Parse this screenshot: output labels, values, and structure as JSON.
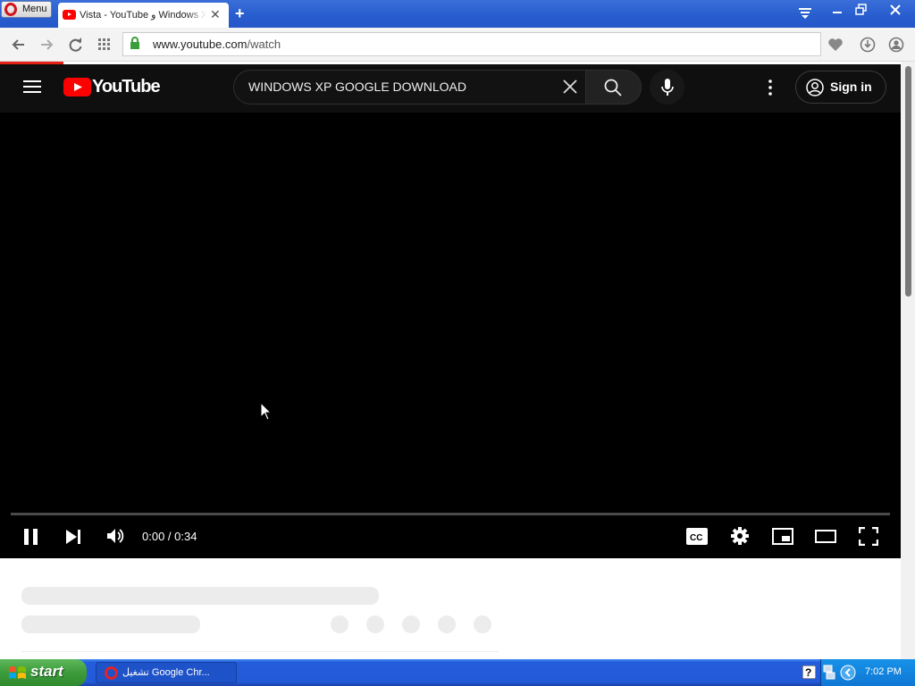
{
  "browser": {
    "menu_label": "Menu",
    "tab_title": "Vista - YouTube و Windows XP",
    "url_host": "www.youtube.com",
    "url_path": "/watch"
  },
  "youtube": {
    "logo_text": "YouTube",
    "search_query": "WINDOWS XP GOOGLE DOWNLOAD",
    "signin_label": "Sign in",
    "time_display": "0:00 / 0:34",
    "playback_fraction": 0
  },
  "taskbar": {
    "start_label": "start",
    "task_label": "تشغيل Google Chr...",
    "clock": "7:02 PM"
  },
  "colors": {
    "youtube_red": "#ff0000",
    "xp_blue": "#245ddb",
    "xp_green": "#3c9c3a",
    "opera_red": "#d3121a"
  },
  "icons": [
    "opera-logo-icon",
    "youtube-favicon",
    "close-tab-icon",
    "new-tab-icon",
    "tab-menu-icon",
    "minimize-icon",
    "restore-icon",
    "close-window-icon",
    "back-icon",
    "forward-icon",
    "reload-icon",
    "speed-dial-icon",
    "lock-icon",
    "heart-icon",
    "download-icon",
    "account-icon",
    "hamburger-icon",
    "youtube-logo-icon",
    "clear-search-icon",
    "search-icon",
    "mic-icon",
    "more-vert-icon",
    "user-icon",
    "pause-icon",
    "next-icon",
    "volume-icon",
    "captions-icon",
    "settings-icon",
    "miniplayer-icon",
    "theater-icon",
    "fullscreen-icon",
    "windows-flag-icon",
    "help-icon",
    "network-icon",
    "tray-arrow-icon"
  ]
}
